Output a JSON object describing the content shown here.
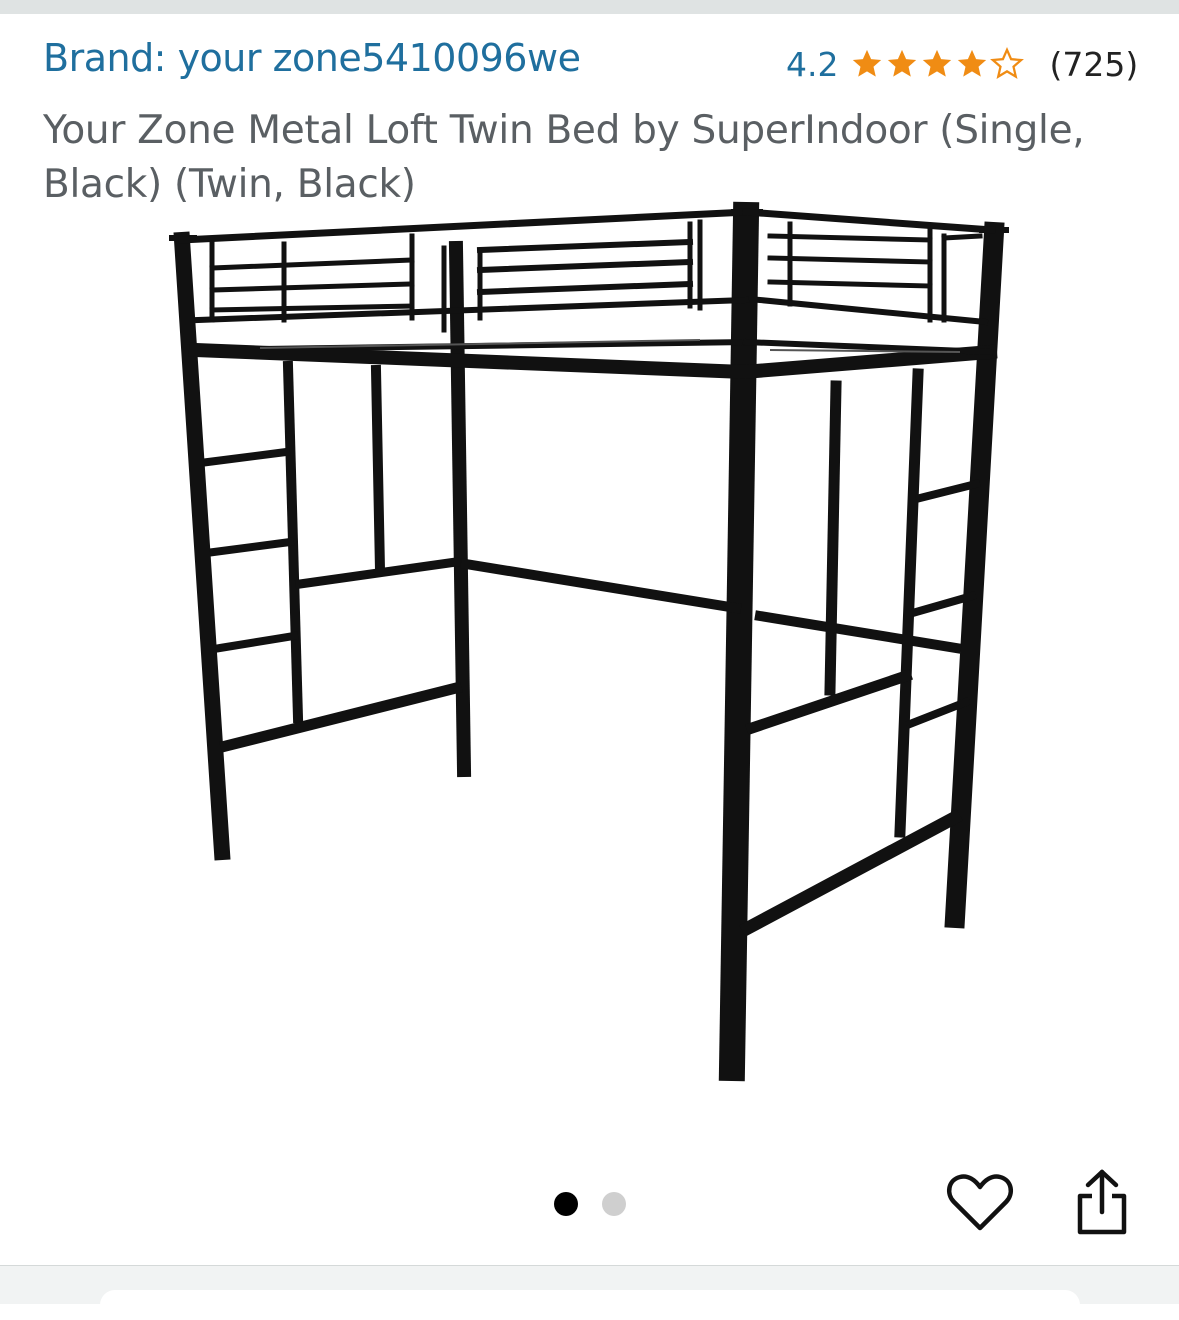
{
  "brand": {
    "label": "Brand: your zone5410096we"
  },
  "rating": {
    "value": "4.2",
    "stars": 4.2,
    "count": "(725)",
    "star_color": "#f08c14"
  },
  "product": {
    "title": "Your Zone Metal Loft Twin Bed by SuperIndoor (Single, Black) (Twin, Black)"
  },
  "gallery": {
    "image_count": 2,
    "active_index": 0,
    "icons": [
      "heart-icon",
      "share-icon"
    ]
  },
  "colors": {
    "link": "#1f6f9e",
    "title": "#5a5f63",
    "frame": "#111111"
  }
}
